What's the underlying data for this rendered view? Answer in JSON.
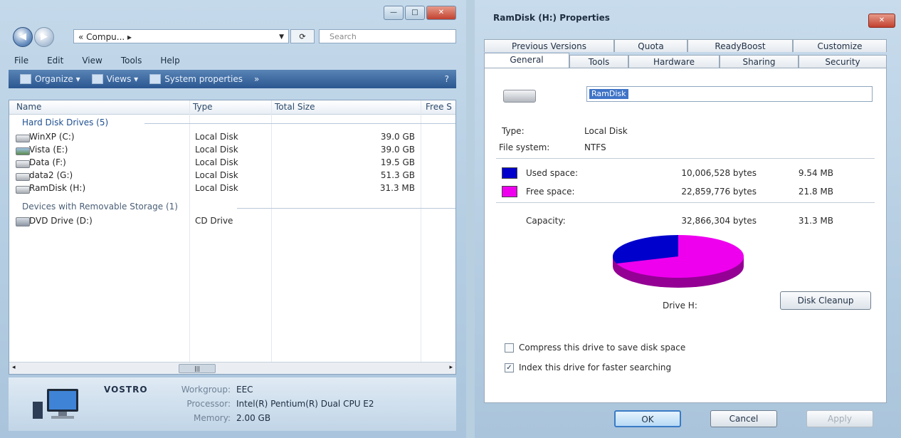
{
  "explorer": {
    "window_buttons": [
      "—",
      "□",
      "✕"
    ],
    "address": "« Compu... ▸",
    "refresh": "⟳",
    "search_placeholder": "Search",
    "menu": [
      "File",
      "Edit",
      "View",
      "Tools",
      "Help"
    ],
    "toolbar": {
      "organize": "Organize ▾",
      "views": "Views ▾",
      "system_properties": "System properties",
      "more": "»",
      "help": "?"
    },
    "columns": [
      "Name",
      "Type",
      "Total Size",
      "Free S"
    ],
    "groups": [
      {
        "header": "Hard Disk Drives (5)",
        "items": [
          {
            "name": "WinXP (C:)",
            "type": "Local Disk",
            "size": "39.0 GB",
            "icon": "disk"
          },
          {
            "name": "Vista (E:)",
            "type": "Local Disk",
            "size": "39.0 GB",
            "icon": "vista"
          },
          {
            "name": "Data (F:)",
            "type": "Local Disk",
            "size": "19.5 GB",
            "icon": "disk"
          },
          {
            "name": "data2 (G:)",
            "type": "Local Disk",
            "size": "51.3 GB",
            "icon": "disk"
          },
          {
            "name": "RamDisk (H:)",
            "type": "Local Disk",
            "size": "31.3 MB",
            "icon": "disk"
          }
        ]
      },
      {
        "header": "Devices with Removable Storage (1)",
        "items": [
          {
            "name": "DVD Drive (D:)",
            "type": "CD Drive",
            "size": "",
            "icon": "dvd"
          }
        ]
      }
    ],
    "scroll": {
      "left": "◂",
      "right": "▸",
      "thumb": "|||"
    },
    "details": {
      "computer_name": "VOSTRO",
      "workgroup_label": "Workgroup:",
      "workgroup_value": "EEC",
      "processor_label": "Processor:",
      "processor_value": "Intel(R) Pentium(R) Dual  CPU  E2",
      "memory_label": "Memory:",
      "memory_value": "2.00 GB"
    }
  },
  "props": {
    "title": "RamDisk (H:) Properties",
    "close": "✕",
    "tabs_row1": [
      "Previous Versions",
      "Quota",
      "ReadyBoost",
      "Customize"
    ],
    "tabs_row2": [
      "General",
      "Tools",
      "Hardware",
      "Sharing",
      "Security"
    ],
    "active_tab": "General",
    "label_value": "RamDisk",
    "type_label": "Type:",
    "type_value": "Local Disk",
    "fs_label": "File system:",
    "fs_value": "NTFS",
    "used": {
      "label": "Used space:",
      "bytes": "10,006,528 bytes",
      "size": "9.54 MB",
      "color": "#0000cc"
    },
    "free": {
      "label": "Free space:",
      "bytes": "22,859,776 bytes",
      "size": "21.8 MB",
      "color": "#ee00ee"
    },
    "capacity": {
      "label": "Capacity:",
      "bytes": "32,866,304 bytes",
      "size": "31.3 MB"
    },
    "pie_used_fraction": 0.304,
    "drive_label": "Drive H:",
    "cleanup_button": "Disk Cleanup",
    "compress_label": "Compress this drive to save disk space",
    "compress_checked": false,
    "index_label": "Index this drive for faster searching",
    "index_checked": true,
    "ok": "OK",
    "cancel": "Cancel",
    "apply": "Apply"
  }
}
